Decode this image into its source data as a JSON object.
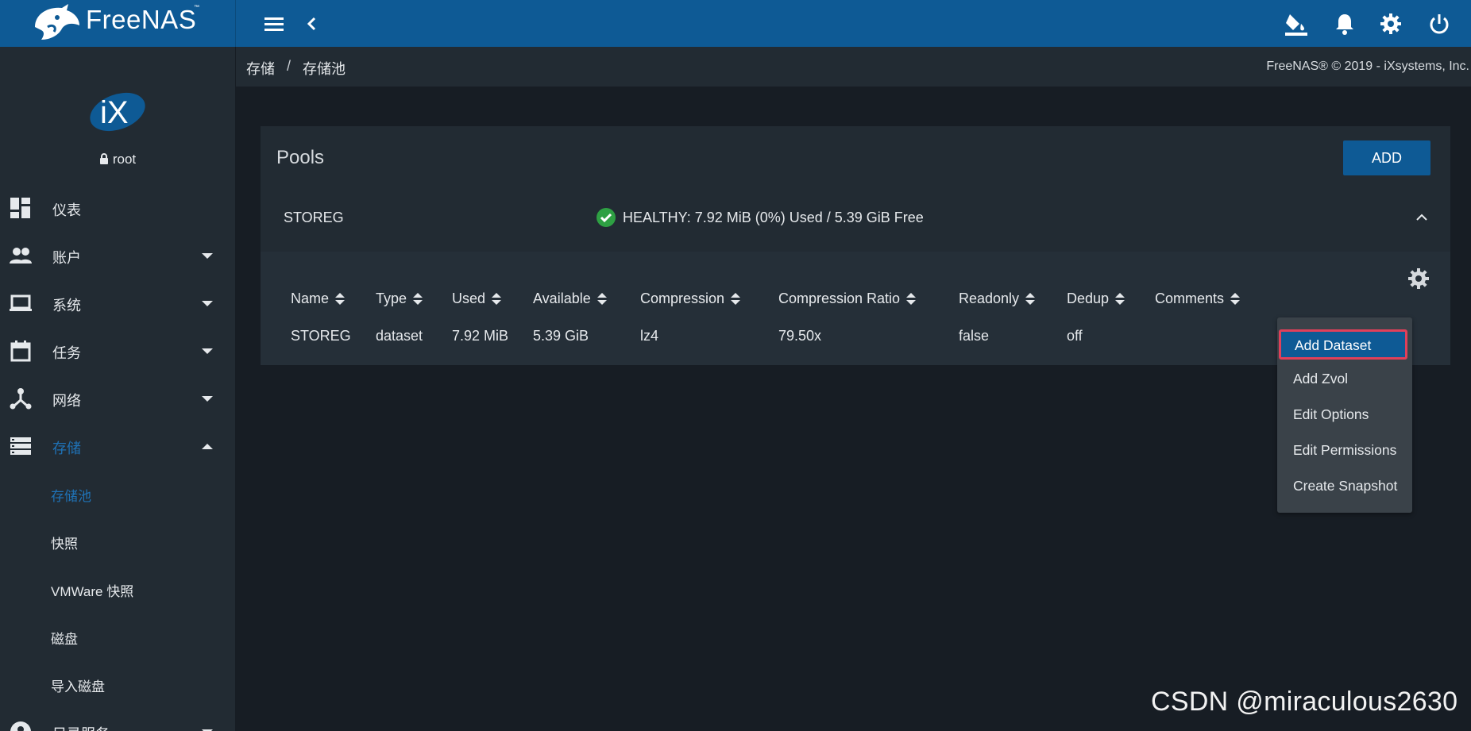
{
  "app": {
    "brand": "FreeNAS",
    "brand_tm": "™",
    "accent": "#0e5a95",
    "active_color": "#1f72b6"
  },
  "topbar": {
    "icons": [
      "menu-icon",
      "chevron-left-icon",
      "paint-bucket-icon",
      "bell-icon",
      "gear-icon",
      "power-icon"
    ]
  },
  "user": {
    "name": "root"
  },
  "sidebar": {
    "items": [
      {
        "label": "仪表",
        "icon": "dashboard-icon"
      },
      {
        "label": "账户",
        "icon": "people-icon"
      },
      {
        "label": "系统",
        "icon": "laptop-icon"
      },
      {
        "label": "任务",
        "icon": "calendar-icon"
      },
      {
        "label": "网络",
        "icon": "network-icon"
      },
      {
        "label": "存储",
        "icon": "storage-icon"
      }
    ],
    "storage_sub": [
      "存储池",
      "快照",
      "VMWare 快照",
      "磁盘",
      "导入磁盘"
    ],
    "partial_item": "目录服务"
  },
  "breadcrumb": {
    "part1": "存储",
    "separator": "/",
    "part2": "存储池"
  },
  "copyright": "FreeNAS® © 2019 - iXsystems, Inc.",
  "pools": {
    "title": "Pools",
    "add_label": "ADD",
    "pool_name": "STOREG",
    "status": "HEALTHY: 7.92 MiB (0%) Used / 5.39 GiB Free",
    "status_color": "#2ea043",
    "columns": [
      "Name",
      "Type",
      "Used",
      "Available",
      "Compression",
      "Compression Ratio",
      "Readonly",
      "Dedup",
      "Comments"
    ],
    "row": [
      "STOREG",
      "dataset",
      "7.92 MiB",
      "5.39 GiB",
      "lz4",
      "79.50x",
      "false",
      "off",
      ""
    ]
  },
  "menu": {
    "items": [
      "Add Dataset",
      "Add Zvol",
      "Edit Options",
      "Edit Permissions",
      "Create Snapshot"
    ],
    "highlight_border": "#e0405a"
  },
  "watermark": "CSDN @miraculous2630"
}
